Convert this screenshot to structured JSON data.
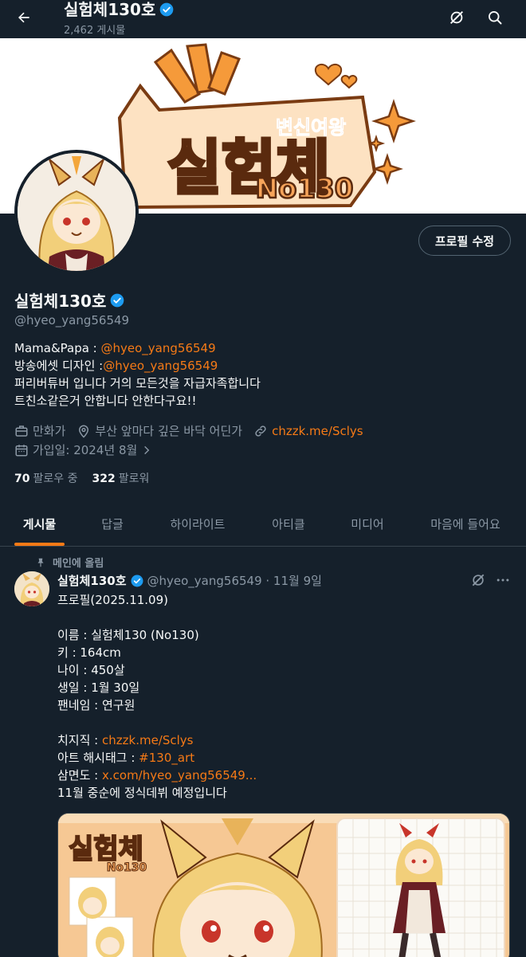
{
  "header": {
    "title": "실험체130호",
    "post_count": "2,462 게시물"
  },
  "profile": {
    "name": "실험체130호",
    "handle": "@hyeo_yang56549",
    "edit_button": "프로필 수정",
    "banner": {
      "subtitle": "변신여왕",
      "title": "실험체",
      "number": "No130"
    },
    "bio": {
      "line1_prefix": "Mama&Papa : ",
      "line1_link": "@hyeo_yang56549",
      "line2_prefix": "방송에셋 디자인 :",
      "line2_link": "@hyeo_yang56549",
      "line3": "퍼리버튜버 입니다 거의 모든것을 자급자족합니다",
      "line4": "트친소같은거 안합니다 안한다구요!!"
    },
    "meta": {
      "job": "만화가",
      "location": "부산 앞마다 깊은 바닥 어딘가",
      "website": "chzzk.me/Sclys",
      "joined": "가입일: 2024년 8월"
    },
    "following_count": "70",
    "following_label": "팔로우 중",
    "followers_count": "322",
    "followers_label": "팔로워"
  },
  "tabs": [
    {
      "label": "게시물",
      "active": true
    },
    {
      "label": "답글",
      "active": false
    },
    {
      "label": "하이라이트",
      "active": false
    },
    {
      "label": "아티클",
      "active": false
    },
    {
      "label": "미디어",
      "active": false
    },
    {
      "label": "마음에 들어요",
      "active": false
    }
  ],
  "post": {
    "pinned_label": "메인에 올림",
    "author": "실험체130호",
    "handle_time": "@hyeo_yang56549 · 11월 9일",
    "lines": {
      "l1": "프로필(2025.11.09)",
      "l2": "이름 : 실험체130 (No130)",
      "l3": "키 : 164cm",
      "l4": "나이 : 450살",
      "l5": "생일 : 1월 30일",
      "l6": "팬네임 : 연구원",
      "l7_prefix": "치지직 : ",
      "l7_link": "chzzk.me/Sclys",
      "l8_prefix": "아트 해시태그 : ",
      "l8_link": "#130_art",
      "l9_prefix": "삼면도 : ",
      "l9_link": "x.com/hyeo_yang56549...",
      "l10": "11월 중순에 정식데뷔 예정입니다"
    },
    "media": {
      "title": "실험체",
      "number": "No130"
    }
  },
  "colors": {
    "background": "#15202b",
    "accent": "#f67a16",
    "verified": "#1d9bf0",
    "muted_text": "#8b98a5",
    "border": "#38444d"
  }
}
